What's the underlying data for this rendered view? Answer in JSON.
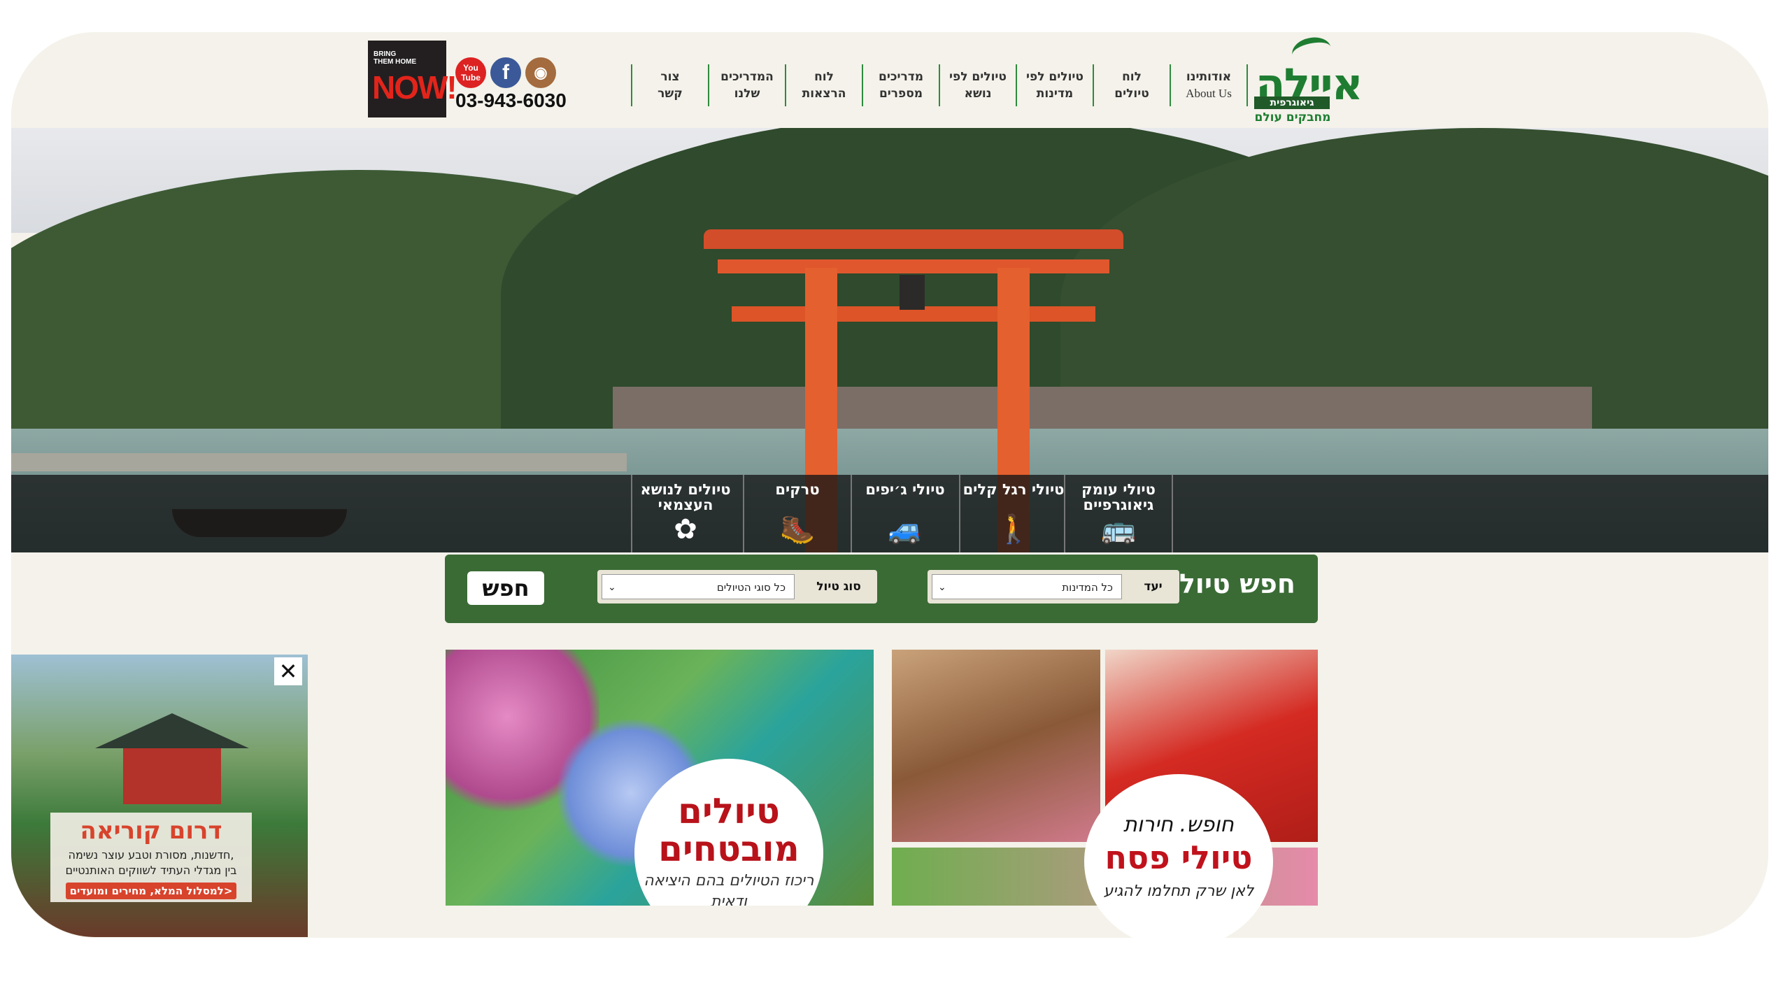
{
  "header": {
    "logo": {
      "name": "איילה",
      "strip": "גיאוגרפית",
      "tagline": "מחבקים עולם"
    },
    "nav": [
      {
        "line1": "אודותינו",
        "line2": "About Us"
      },
      {
        "line1": "לוח",
        "line2": "טיולים"
      },
      {
        "line1": "טיולים לפי",
        "line2": "מדינות"
      },
      {
        "line1": "טיולים לפי",
        "line2": "נושא"
      },
      {
        "line1": "מדריכים",
        "line2": "מספרים"
      },
      {
        "line1": "לוח",
        "line2": "הרצאות"
      },
      {
        "line1": "המדריכים",
        "line2": "שלנו"
      },
      {
        "line1": "צור",
        "line2": "קשר"
      }
    ],
    "phone": "03-943-6030",
    "social": {
      "youtube": "You Tube",
      "facebook": "f",
      "instagram": "◉"
    },
    "banner": {
      "line1": "BRING",
      "line2": "THEM HOME",
      "big": "NOW!"
    }
  },
  "categories": [
    {
      "label": "טיולי עומק גיאוגרפיים",
      "icon": "bus-icon",
      "glyph": "🚌"
    },
    {
      "label": "טיולי רגל קלים",
      "icon": "hikers-icon",
      "glyph": "🚶"
    },
    {
      "label": "טיולי ג׳יפים",
      "icon": "jeep-icon",
      "glyph": "🚙"
    },
    {
      "label": "טרקים",
      "icon": "trekkers-icon",
      "glyph": "🥾"
    },
    {
      "label": "טיולים לנושא העצמאי",
      "icon": "flower-icon",
      "glyph": "✿"
    }
  ],
  "search": {
    "title": "חפש טיול",
    "destination_label": "יעד",
    "destination_value": "כל המדינות",
    "type_label": "סוג טיול",
    "type_value": "כל סוגי הטיולים",
    "button": "חפש"
  },
  "tiles": {
    "left": {
      "title": "טיולים מובטחים",
      "subtitle": "ריכוז הטיולים בהם היציאה ודאית"
    },
    "right": {
      "line1": "חופש. חירות",
      "title": "טיולי פסח",
      "line3": "לאן שרק תחלמו להגיע"
    }
  },
  "popup": {
    "close": "✕",
    "title": "דרום קוריאה",
    "desc_line1": "חדשנות, מסורת וטבע עוצר נשימה,",
    "desc_line2": "בין מגדלי העתיד לשווקים האותנטיים",
    "cta": "למסלול המלא, מחירים ומועדים>"
  }
}
